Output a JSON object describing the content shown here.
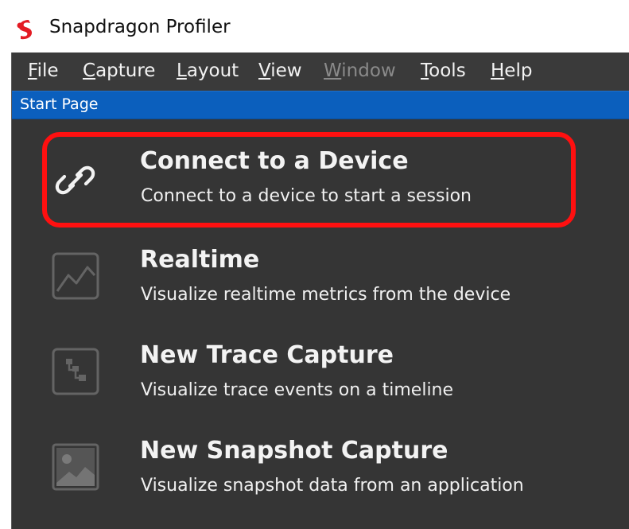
{
  "app": {
    "title": "Snapdragon Profiler",
    "logo_icon": "snapdragon-logo-icon"
  },
  "menu": {
    "items": [
      {
        "accel": "F",
        "rest": "ile",
        "enabled": true
      },
      {
        "accel": "C",
        "rest": "apture",
        "enabled": true
      },
      {
        "accel": "L",
        "rest": "ayout",
        "enabled": true
      },
      {
        "accel": "V",
        "rest": "iew",
        "enabled": true
      },
      {
        "accel": "W",
        "rest": "indow",
        "enabled": false
      },
      {
        "accel": "T",
        "rest": "ools",
        "enabled": true
      },
      {
        "accel": "H",
        "rest": "elp",
        "enabled": true
      }
    ]
  },
  "tab": {
    "label": "Start Page"
  },
  "start_page": {
    "actions": [
      {
        "title": "Connect to a Device",
        "subtitle": "Connect to a device to start a session",
        "icon": "link-icon",
        "highlighted": true
      },
      {
        "title": "Realtime",
        "subtitle": "Visualize realtime metrics from the device",
        "icon": "line-chart-icon",
        "highlighted": false
      },
      {
        "title": "New Trace Capture",
        "subtitle": "Visualize trace events on a timeline",
        "icon": "trace-timeline-icon",
        "highlighted": false
      },
      {
        "title": "New Snapshot Capture",
        "subtitle": "Visualize snapshot data from an application",
        "icon": "image-snapshot-icon",
        "highlighted": false
      }
    ]
  },
  "colors": {
    "window_background": "#3a3a3a",
    "content_background": "#353535",
    "tab_blue": "#0b5fbd",
    "highlight_red": "#ff1010",
    "logo_red": "#e31b23",
    "text_primary": "#f3f3f3",
    "text_disabled": "#8a8a8a"
  }
}
